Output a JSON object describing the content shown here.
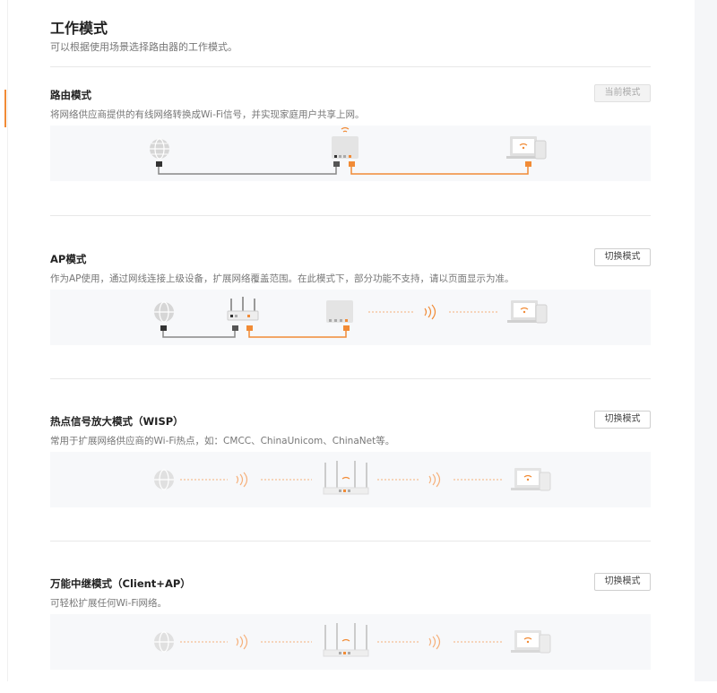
{
  "page": {
    "title": "工作模式",
    "subtitle": "可以根据使用场景选择路由器的工作模式。"
  },
  "colors": {
    "accent": "#f18b36",
    "gray_line": "#888888",
    "icon_gray": "#cfcfcf"
  },
  "modes": [
    {
      "title": "路由模式",
      "description": "将网络供应商提供的有线网络转换成Wi-Fi信号，并实现家庭用户共享上网。",
      "button_label": "当前模式",
      "button_state": "current"
    },
    {
      "title": "AP模式",
      "description": "作为AP使用，通过网线连接上级设备，扩展网络覆盖范围。在此模式下，部分功能不支持，请以页面显示为准。",
      "button_label": "切换模式",
      "button_state": "switch"
    },
    {
      "title": "热点信号放大模式（WISP）",
      "description": "常用于扩展网络供应商的Wi-Fi热点，如：CMCC、ChinaUnicom、ChinaNet等。",
      "button_label": "切换模式",
      "button_state": "switch"
    },
    {
      "title": "万能中继模式（Client+AP）",
      "description": "可轻松扩展任何Wi-Fi网络。",
      "button_label": "切换模式",
      "button_state": "switch"
    }
  ]
}
